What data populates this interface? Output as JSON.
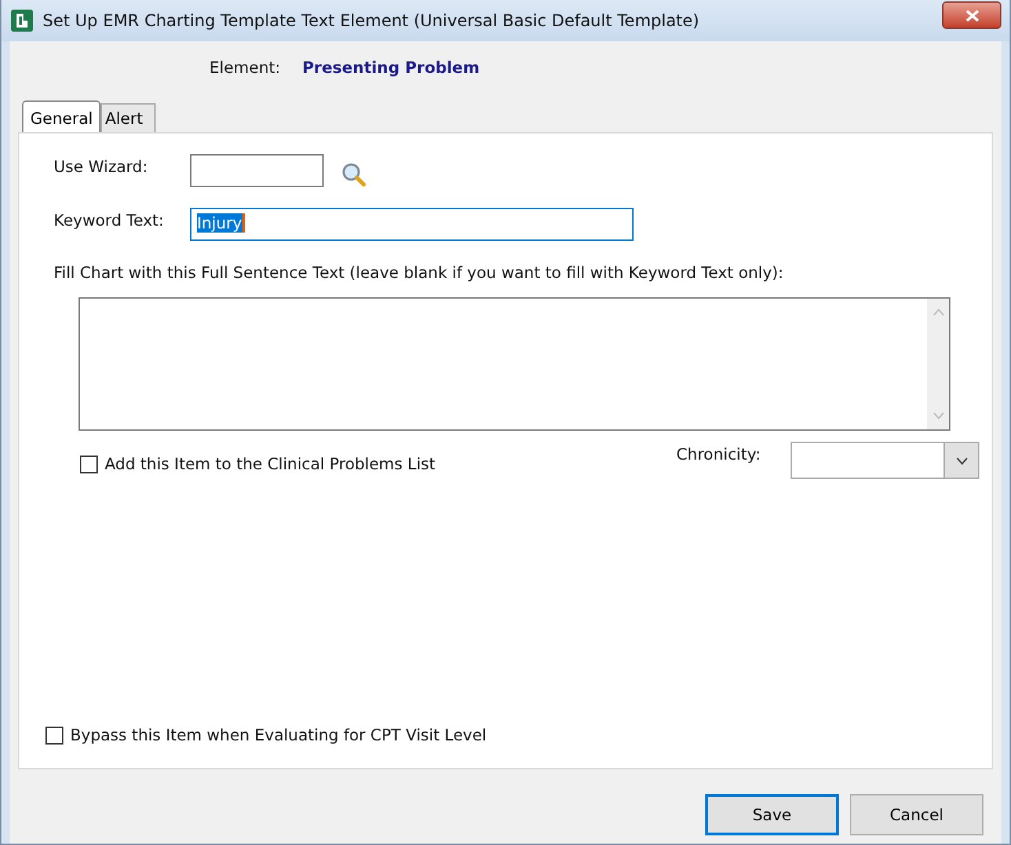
{
  "window": {
    "title": "Set Up EMR Charting Template Text Element (Universal Basic Default Template)"
  },
  "element": {
    "label": "Element:",
    "value": "Presenting Problem"
  },
  "tabs": [
    {
      "label": "General",
      "selected": true
    },
    {
      "label": "Alert",
      "selected": false
    }
  ],
  "use_wizard": {
    "label": "Use Wizard:"
  },
  "keyword": {
    "label": "Keyword Text:",
    "value": "Injury",
    "text_selected": true
  },
  "full_sentence": {
    "label": "Fill Chart with this Full Sentence Text (leave blank if you want to fill with Keyword Text only):"
  },
  "checkboxes": [
    {
      "label": "Add this Item to the Clinical Problems List",
      "checked": false
    },
    {
      "label": "Bypass this Item when Evaluating for CPT Visit Level",
      "checked": false
    }
  ],
  "chronicity": {
    "label": "Chronicity:"
  },
  "buttons": [
    {
      "label": "Save",
      "default": true
    },
    {
      "label": "Cancel",
      "default": false
    }
  ]
}
